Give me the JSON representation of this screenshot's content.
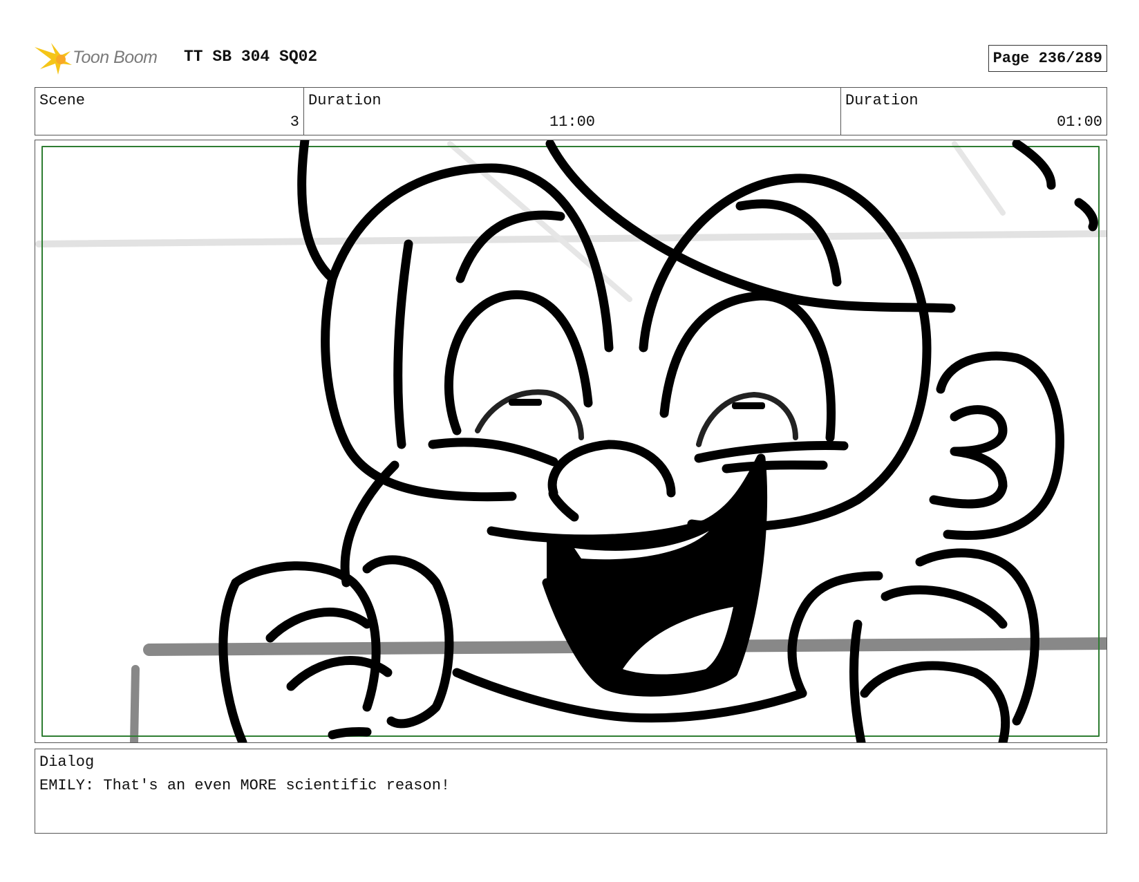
{
  "header": {
    "logo_text": "Toon Boom",
    "logo_icon": "toon-boom-star-icon",
    "project_title": "TT SB 304 SQ02",
    "page_label": "Page 236/289"
  },
  "info": {
    "scene_label": "Scene",
    "scene_value": "3",
    "duration1_label": "Duration",
    "duration1_value": "11:00",
    "duration2_label": "Duration",
    "duration2_value": "01:00"
  },
  "panel": {
    "description_icon": "storyboard-drawing",
    "safe_frame_color": "#2e7d32"
  },
  "dialog": {
    "label": "Dialog",
    "text": "EMILY: That's an even MORE scientific reason!"
  }
}
